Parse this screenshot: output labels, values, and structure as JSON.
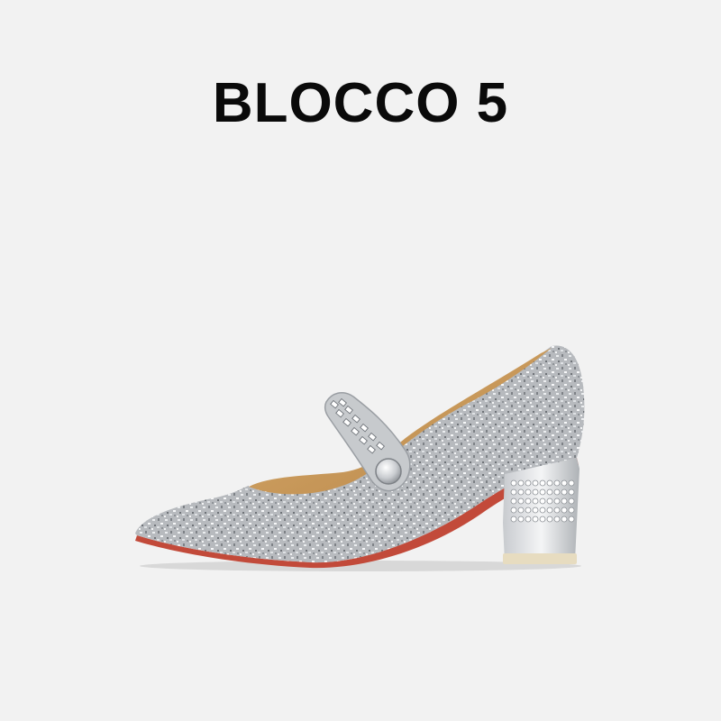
{
  "brand": {
    "title": "BLOCCO 5"
  },
  "product": {
    "image_subject": "silver-glitter-mary-jane-pump"
  },
  "colors": {
    "background": "#f2f2f2",
    "title": "#0a0a0a",
    "glitter": "#b9bcc0",
    "lining": "#c9985a",
    "sole": "#c24a3a"
  }
}
